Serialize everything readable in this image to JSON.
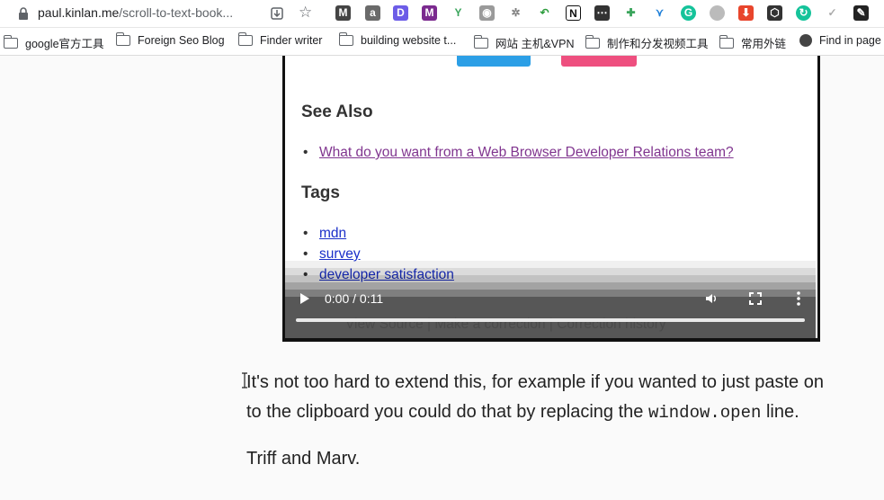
{
  "browser": {
    "url_host": "paul.kinlan.me",
    "url_path": "/scroll-to-text-book...",
    "bookmarks": [
      "google官方工具",
      "Foreign Seo Blog",
      "Finder writer",
      "building website t...",
      "网站 主机&VPN",
      "制作和分发视频工具",
      "常用外链",
      "Find in page"
    ],
    "extension_glyphs": [
      "M",
      "a",
      "D",
      "M",
      "Y",
      "G"
    ],
    "colors": {
      "accent_blue": "#2c9fe6",
      "accent_pink": "#ee4f7f",
      "visited_link": "#80358f",
      "link": "#1a2fc9"
    }
  },
  "video": {
    "see_also_heading": "See Also",
    "see_also_link": "What do you want from a Web Browser Developer Relations team?",
    "tags_heading": "Tags",
    "tags": [
      "mdn",
      "survey",
      "developer satisfaction"
    ],
    "faded_footer": "View Source  |  Make a correction  |  Correction history",
    "time_display": "0:00 / 0:11",
    "progress": 0.0,
    "icons": [
      "play-icon",
      "volume-icon",
      "fullscreen-icon",
      "more-options-icon"
    ]
  },
  "article": {
    "para1_line1": "It's not too hard to extend this, for example if you wanted to just paste on",
    "para1_line2_pre": "to the clipboard you could do that by replacing the ",
    "para1_code": "window.open",
    "para1_line2_post": " line.",
    "para2": "Triff and Marv."
  }
}
